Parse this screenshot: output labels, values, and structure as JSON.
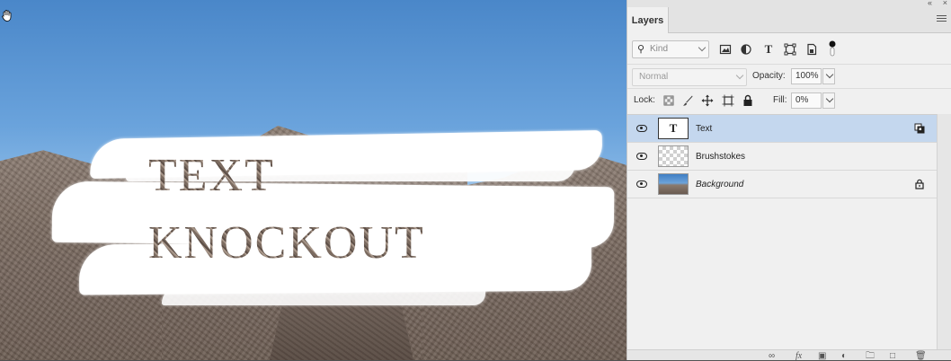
{
  "canvas": {
    "text_line1": "TEXT",
    "text_line2": "KNOCKOUT",
    "tool_icon": "hand-tool-icon"
  },
  "panel": {
    "collapse_icon": "double-chevron-icon",
    "close_icon": "close-icon",
    "tab_label": "Layers",
    "menu_icon": "panel-menu-icon",
    "filter": {
      "kind_placeholder": "Kind",
      "icons": [
        "pixel-layer-filter-icon",
        "adjustment-layer-filter-icon",
        "type-layer-filter-icon",
        "shape-layer-filter-icon",
        "smart-object-filter-icon",
        "filter-toggle-icon"
      ]
    },
    "blend": {
      "mode": "Normal",
      "opacity_label": "Opacity:",
      "opacity_value": "100%"
    },
    "lock": {
      "label": "Lock:",
      "icons": [
        "lock-transparent-pixels-icon",
        "lock-image-pixels-icon",
        "lock-position-icon",
        "lock-artboard-icon",
        "lock-all-icon"
      ],
      "fill_label": "Fill:",
      "fill_value": "0%"
    },
    "layers": [
      {
        "name": "Text",
        "type": "text",
        "selected": true,
        "visible": true
      },
      {
        "name": "Brushstokes",
        "type": "pixel",
        "selected": false,
        "visible": true
      },
      {
        "name": "Background",
        "type": "background",
        "selected": false,
        "visible": true,
        "locked": true
      }
    ],
    "bottom_icons": [
      "link-layers-icon",
      "layer-style-icon",
      "add-mask-icon",
      "adjustment-icon",
      "group-icon",
      "new-layer-icon",
      "delete-icon"
    ]
  },
  "colors": {
    "selection": "#c4d7ee",
    "panel_bg": "#f0f0f0",
    "sky": "#6aa3dc"
  }
}
